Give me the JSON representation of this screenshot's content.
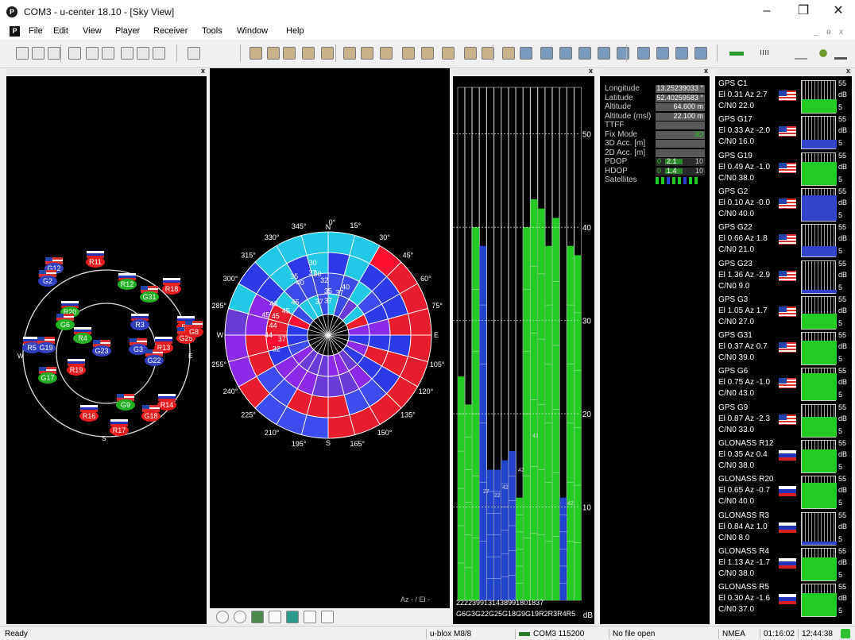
{
  "window": {
    "title": "COM3 - u-center 18.10 - [Sky View]",
    "app_icon": "P",
    "minimize": "–",
    "restore": "❐",
    "close": "✕"
  },
  "menu": {
    "items": [
      "File",
      "Edit",
      "View",
      "Player",
      "Receiver",
      "Tools",
      "Window",
      "Help"
    ],
    "mdi_controls": [
      "_",
      "ɵ",
      "x"
    ]
  },
  "toolbar": {
    "buttons": [
      "new-icon",
      "open-icon",
      "save-icon",
      "print-icon",
      "preview-icon",
      "cut-icon",
      "copy-icon",
      "paste-icon",
      "settings-icon"
    ],
    "dropdown_label": "ıııı"
  },
  "skyview_pane": {
    "directions": {
      "north": "N",
      "east": "E",
      "south": "S",
      "west": "W"
    },
    "satellites": [
      {
        "id": "R11",
        "flag": "ru",
        "color": "#e81c1c"
      },
      {
        "id": "G12",
        "flag": "us",
        "color": "#3040c0"
      },
      {
        "id": "G2",
        "flag": "us",
        "color": "#3040c0"
      },
      {
        "id": "R12",
        "flag": "ru",
        "color": "#20b020"
      },
      {
        "id": "G31",
        "flag": "us",
        "color": "#20b020"
      },
      {
        "id": "R18",
        "flag": "ru",
        "color": "#e81c1c"
      },
      {
        "id": "R20",
        "flag": "ru",
        "color": "#20b020"
      },
      {
        "id": "G6",
        "flag": "us",
        "color": "#20b020"
      },
      {
        "id": "R3",
        "flag": "ru",
        "color": "#3040c0"
      },
      {
        "id": "R2",
        "flag": "ru",
        "color": "#e81c1c"
      },
      {
        "id": "G25",
        "flag": "us",
        "color": "#e81c1c"
      },
      {
        "id": "R4",
        "flag": "ru",
        "color": "#20b020"
      },
      {
        "id": "G23",
        "flag": "us",
        "color": "#3040c0"
      },
      {
        "id": "G3",
        "flag": "us",
        "color": "#3040c0"
      },
      {
        "id": "R13",
        "flag": "ru",
        "color": "#e81c1c"
      },
      {
        "id": "G22",
        "flag": "us",
        "color": "#3040c0"
      },
      {
        "id": "R5",
        "flag": "ru",
        "color": "#3040c0"
      },
      {
        "id": "G19",
        "flag": "us",
        "color": "#3040c0"
      },
      {
        "id": "R19",
        "flag": "ru",
        "color": "#e81c1c"
      },
      {
        "id": "G17",
        "flag": "us",
        "color": "#20b020"
      },
      {
        "id": "G9",
        "flag": "us",
        "color": "#20b020"
      },
      {
        "id": "R14",
        "flag": "ru",
        "color": "#e81c1c"
      },
      {
        "id": "G18",
        "flag": "us",
        "color": "#e81c1c"
      },
      {
        "id": "R16",
        "flag": "ru",
        "color": "#e81c1c"
      },
      {
        "id": "R17",
        "flag": "ru",
        "color": "#e81c1c"
      },
      {
        "id": "G8",
        "flag": "us",
        "color": "#e81c1c"
      }
    ]
  },
  "polar_pane": {
    "azimuth_labels": [
      "N",
      "0°",
      "15°",
      "30°",
      "45°",
      "60°",
      "75°",
      "E",
      "105°",
      "120°",
      "135°",
      "150°",
      "165°",
      "S",
      "195°",
      "210°",
      "225°",
      "240°",
      "255°",
      "W",
      "285°",
      "300°",
      "315°",
      "330°",
      "345°"
    ],
    "cell_values": [
      "37",
      "37",
      "35",
      "37",
      "40",
      "45",
      "45",
      "45",
      "44",
      "45",
      "40",
      "32",
      "30",
      "40",
      "35",
      "30",
      "37",
      "44",
      "37",
      "32"
    ],
    "footer": "Az - / El -",
    "bottom_tools": [
      "target-icon",
      "circle-icon",
      "grid-icon",
      "compass-icon",
      "arrow-icon",
      "chart-icon",
      "curve-icon"
    ]
  },
  "cn0_pane": {
    "y_ticks": [
      "50",
      "40",
      "30",
      "20",
      "10",
      "dB"
    ],
    "bars": [
      {
        "label": "G2",
        "value": 24,
        "color": "#22cc22"
      },
      {
        "label": "G3",
        "value": 21,
        "color": "#22cc22"
      },
      {
        "label": "G6",
        "value": 40,
        "color": "#22cc22"
      },
      {
        "label": "G8",
        "value": 38,
        "color": "#2244cc"
      },
      {
        "label": "G9",
        "value": 14,
        "color": "#2244cc"
      },
      {
        "label": "G12",
        "value": 14,
        "color": "#2244cc"
      },
      {
        "label": "G17",
        "value": 15,
        "color": "#2244cc"
      },
      {
        "label": "G18",
        "value": 16,
        "color": "#2244cc"
      },
      {
        "label": "G19",
        "value": 11,
        "color": "#22cc22"
      },
      {
        "label": "G22",
        "value": 40,
        "color": "#22cc22"
      },
      {
        "label": "G23",
        "value": 43,
        "color": "#22cc22"
      },
      {
        "label": "G25",
        "value": 42,
        "color": "#22cc22"
      },
      {
        "label": "G31",
        "value": 38,
        "color": "#22cc22"
      },
      {
        "label": "R2",
        "value": 41,
        "color": "#22cc22"
      },
      {
        "label": "R3",
        "value": 11,
        "color": "#2244cc"
      },
      {
        "label": "R4",
        "value": 38,
        "color": "#22cc22"
      },
      {
        "label": "R5",
        "value": 37,
        "color": "#22cc22"
      }
    ],
    "bar_top_labels": [
      "27",
      "22",
      "42",
      "42",
      "42",
      "42"
    ],
    "bottom_labels": "G6G3G22G25G18G9G19R2R3R4R5",
    "top_row_labels": "2222399131438991801837"
  },
  "nav_pane": {
    "rows": [
      {
        "label": "Longitude",
        "value": "13.25239033 °"
      },
      {
        "label": "Latitude",
        "value": "52.40259583 °"
      },
      {
        "label": "Altitude",
        "value": "64.600 m"
      },
      {
        "label": "Altitude (msl)",
        "value": "22.100 m"
      },
      {
        "label": "TTFF",
        "value": ""
      },
      {
        "label": "Fix Mode",
        "value": "3D"
      },
      {
        "label": "3D Acc. [m]",
        "value": ""
      },
      {
        "label": "2D Acc. [m]",
        "value": ""
      },
      {
        "label": "PDOP",
        "value": "0",
        "value2": "2.1",
        "value3": "10"
      },
      {
        "label": "HDOP",
        "value": "0",
        "value2": "1.4",
        "value3": "10"
      },
      {
        "label": "Satellites",
        "value": ""
      }
    ]
  },
  "signal_list_pane": {
    "axis": {
      "top": "55",
      "unit": "dB",
      "bottom": "5"
    },
    "satellites": [
      {
        "name": "GPS C1",
        "line2": "El 0.31 Az 2.7",
        "line3": "C/N0 22.0",
        "flag": "us",
        "fill": 0.4,
        "color": "#22cc22"
      },
      {
        "name": "GPS G17",
        "line2": "El 0.33 Az -2.0",
        "line3": "C/N0 16.0",
        "flag": "us",
        "fill": 0.25,
        "color": "#3344cc"
      },
      {
        "name": "GPS G19",
        "line2": "El 0.49 Az -1.0",
        "line3": "C/N0 38.0",
        "flag": "us",
        "fill": 0.7,
        "color": "#22cc22"
      },
      {
        "name": "GPS G2",
        "line2": "El 0.10 Az -0.0",
        "line3": "C/N0 40.0",
        "flag": "us",
        "fill": 0.75,
        "color": "#3344cc"
      },
      {
        "name": "GPS G22",
        "line2": "El 0.66 Az 1.8",
        "line3": "C/N0 21.0",
        "flag": "us",
        "fill": 0.3,
        "color": "#3344cc"
      },
      {
        "name": "GPS G23",
        "line2": "El 1.36 Az -2.9",
        "line3": "C/N0 9.0",
        "flag": "us",
        "fill": 0.1,
        "color": "#3344cc"
      },
      {
        "name": "GPS G3",
        "line2": "El 1.05 Az 1.7",
        "line3": "C/N0 27.0",
        "flag": "us",
        "fill": 0.45,
        "color": "#22cc22"
      },
      {
        "name": "GPS G31",
        "line2": "El 0.37 Az 0.7",
        "line3": "C/N0 39.0",
        "flag": "us",
        "fill": 0.72,
        "color": "#22cc22"
      },
      {
        "name": "GPS G6",
        "line2": "El 0.75 Az -1.0",
        "line3": "C/N0 43.0",
        "flag": "us",
        "fill": 0.8,
        "color": "#22cc22"
      },
      {
        "name": "GPS G9",
        "line2": "El 0.87 Az -2.3",
        "line3": "C/N0 33.0",
        "flag": "us",
        "fill": 0.6,
        "color": "#22cc22"
      },
      {
        "name": "GLONASS R12",
        "line2": "El 0.35 Az 0.4",
        "line3": "C/N0 38.0",
        "flag": "ru",
        "fill": 0.7,
        "color": "#22cc22"
      },
      {
        "name": "GLONASS R20",
        "line2": "El 0.65 Az -0.7",
        "line3": "C/N0 40.0",
        "flag": "ru",
        "fill": 0.75,
        "color": "#22cc22"
      },
      {
        "name": "GLONASS R3",
        "line2": "El 0.84 Az 1.0",
        "line3": "C/N0 8.0",
        "flag": "ru",
        "fill": 0.1,
        "color": "#3344cc"
      },
      {
        "name": "GLONASS R4",
        "line2": "El 1.13 Az -1.7",
        "line3": "C/N0 38.0",
        "flag": "ru",
        "fill": 0.7,
        "color": "#22cc22"
      },
      {
        "name": "GLONASS R5",
        "line2": "El 0.30 Az -1.6",
        "line3": "C/N0 37.0",
        "flag": "ru",
        "fill": 0.68,
        "color": "#22cc22"
      }
    ]
  },
  "status": {
    "ready": "Ready",
    "device": "u-blox M8/8",
    "port": "COM3 115200",
    "file": "No file open",
    "protocol": "NMEA",
    "elapsed": "01:16:02",
    "clock": "12:44:38"
  }
}
